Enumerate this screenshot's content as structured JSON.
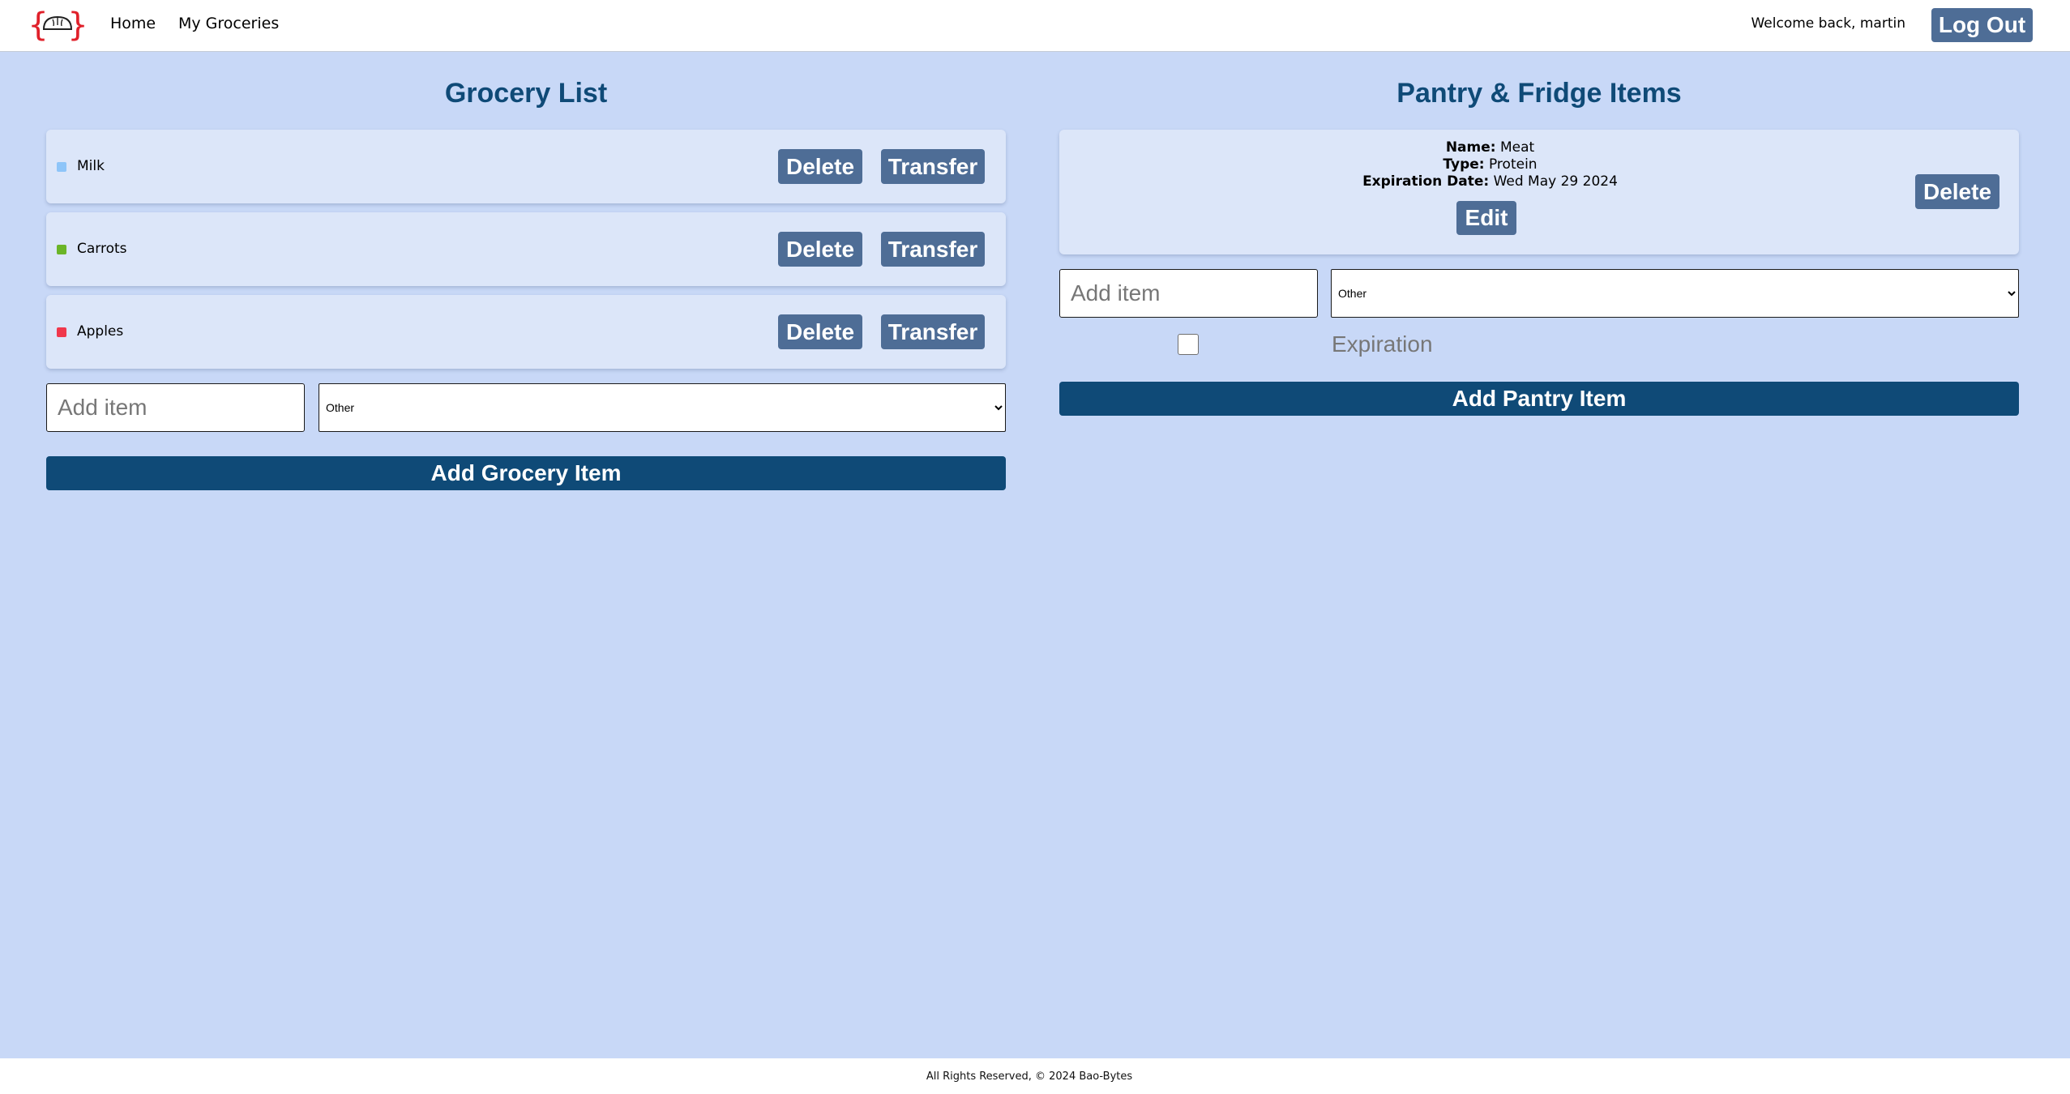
{
  "nav": {
    "home_label": "Home",
    "groceries_label": "My Groceries",
    "welcome_text": "Welcome back, martin",
    "logout_label": "Log Out",
    "logo_icon": "bao-bun-logo-icon"
  },
  "grocery": {
    "title": "Grocery List",
    "items": [
      {
        "name": "Milk",
        "color": "#8ec5f9"
      },
      {
        "name": "Carrots",
        "color": "#6bb528"
      },
      {
        "name": "Apples",
        "color": "#f0384c"
      }
    ],
    "delete_label": "Delete",
    "transfer_label": "Transfer",
    "input_placeholder": "Add item",
    "select_value": "Other",
    "add_label": "Add Grocery Item"
  },
  "pantry": {
    "title": "Pantry & Fridge Items",
    "item": {
      "name_label": "Name:",
      "name": "Meat",
      "type_label": "Type:",
      "type": "Protein",
      "expiration_label": "Expiration Date:",
      "expiration": "Wed May 29 2024"
    },
    "edit_label": "Edit",
    "delete_label": "Delete",
    "input_placeholder": "Add item",
    "select_value": "Other",
    "expiration_placeholder": "Expiration",
    "add_label": "Add Pantry Item"
  },
  "footer": {
    "text": "All Rights Reserved, © 2024 Bao-Bytes"
  },
  "colors": {
    "background": "#c8d8f7",
    "card": "#dce6f9",
    "button": "#4e6d96",
    "primary": "#0f4a77",
    "logo_brace": "#e0202a"
  }
}
